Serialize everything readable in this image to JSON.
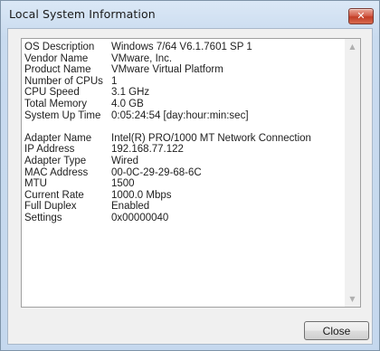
{
  "window": {
    "title": "Local System Information",
    "close_glyph": "✕"
  },
  "system": [
    {
      "label": "OS Description",
      "value": "Windows 7/64  V6.1.7601 SP 1"
    },
    {
      "label": "Vendor Name",
      "value": "VMware, Inc."
    },
    {
      "label": "Product Name",
      "value": "VMware Virtual Platform"
    },
    {
      "label": "Number of CPUs",
      "value": "1"
    },
    {
      "label": "CPU Speed",
      "value": "3.1 GHz"
    },
    {
      "label": "Total Memory",
      "value": "4.0 GB"
    },
    {
      "label": "System Up Time",
      "value": "0:05:24:54  [day:hour:min:sec]"
    }
  ],
  "adapter": [
    {
      "label": "Adapter Name",
      "value": "Intel(R) PRO/1000 MT Network Connection"
    },
    {
      "label": "IP Address",
      "value": "192.168.77.122"
    },
    {
      "label": "Adapter Type",
      "value": "Wired"
    },
    {
      "label": "MAC Address",
      "value": "00-0C-29-29-68-6C"
    },
    {
      "label": "MTU",
      "value": "1500"
    },
    {
      "label": "Current Rate",
      "value": "1000.0 Mbps"
    },
    {
      "label": "Full Duplex",
      "value": "Enabled"
    },
    {
      "label": "Settings",
      "value": "0x00000040"
    }
  ],
  "buttons": {
    "close_label": "Close"
  },
  "icons": {
    "scroll_up": "scroll-up-arrow-icon",
    "scroll_down": "scroll-down-arrow-icon",
    "title_close": "close-icon"
  }
}
